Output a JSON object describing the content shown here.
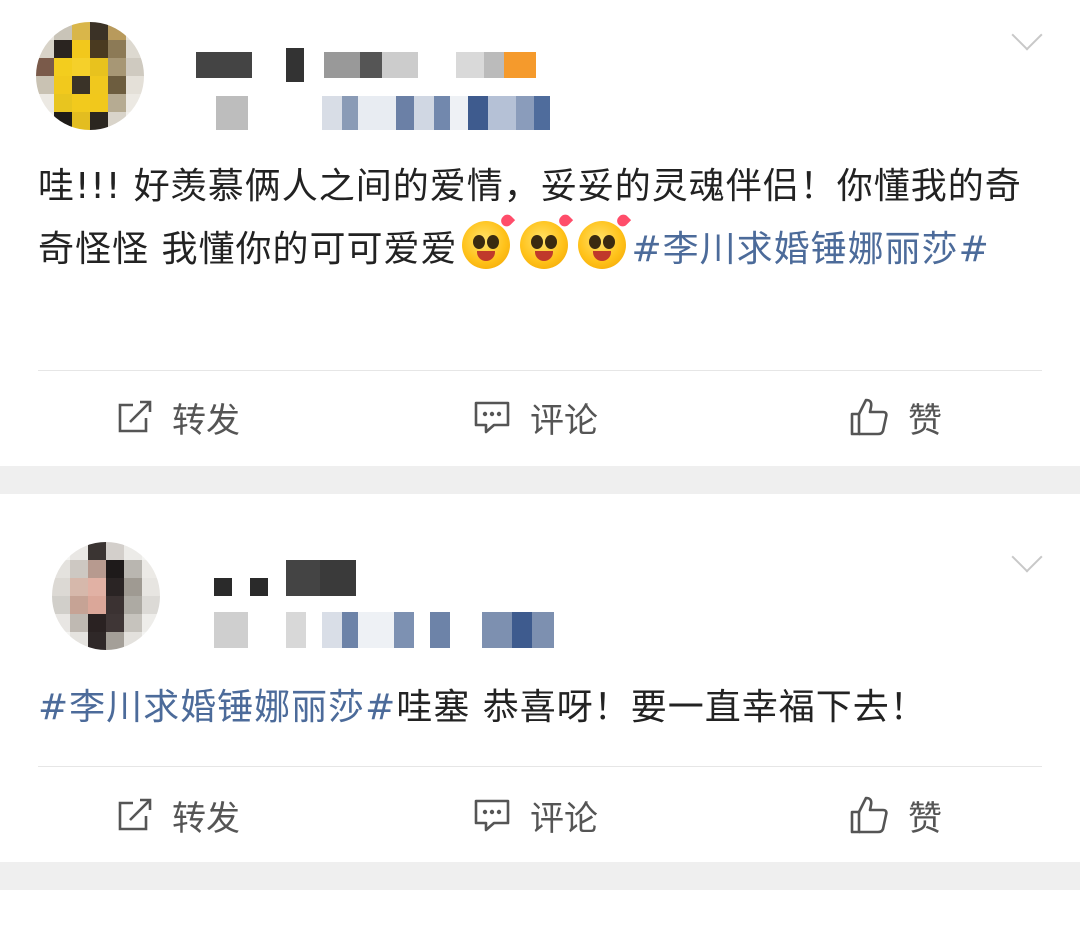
{
  "posts": [
    {
      "text_plain": "哇!!! 好羡慕俩人之间的爱情，妥妥的灵魂伴侣！你懂我的奇奇怪怪 我懂你的可可爱爱",
      "hashtag": "#李川求婚锤娜丽莎#",
      "emoji_names": [
        "hugging-face-emoji",
        "hugging-face-emoji",
        "hugging-face-emoji"
      ],
      "actions": {
        "repost": "转发",
        "comment": "评论",
        "like": "赞"
      }
    },
    {
      "hashtag": "#李川求婚锤娜丽莎#",
      "text_plain": "哇塞 恭喜呀！要一直幸福下去！",
      "actions": {
        "repost": "转发",
        "comment": "评论",
        "like": "赞"
      }
    }
  ],
  "colors": {
    "hashtag": "#4c6b9a",
    "separator": "#efefef",
    "action_text": "#555555"
  },
  "icons": [
    "repost-icon",
    "comment-icon",
    "like-icon",
    "chevron-down-icon"
  ]
}
